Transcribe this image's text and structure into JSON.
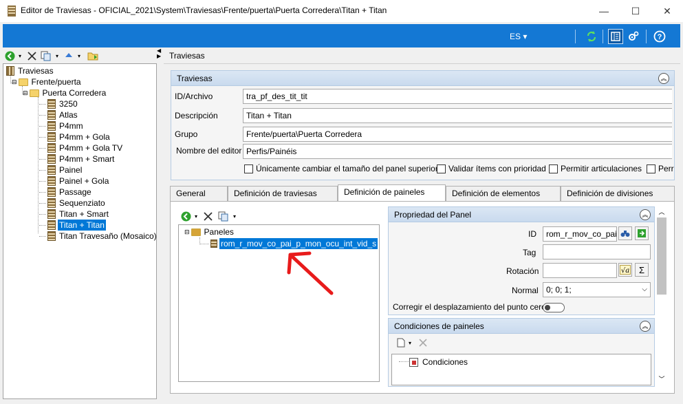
{
  "window": {
    "title": "Editor de Traviesas - OFICIAL_2021\\System\\Traviesas\\Frente/puerta\\Puerta Corredera\\Titan + Titan",
    "minimize_glyph": "—",
    "maximize_glyph": "☐",
    "close_glyph": "✕"
  },
  "ribbon": {
    "language": "ES ▾",
    "accent": "#1478d4",
    "icons": [
      "refresh-icon",
      "panel-view-icon",
      "settings-icon",
      "help-icon"
    ]
  },
  "left_toolbar": {
    "icons": [
      "back-icon",
      "chevron-down-icon",
      "delete-icon",
      "copy-icon",
      "chevron-down-icon",
      "move-up-icon",
      "chevron-down-icon",
      "open-folder-icon"
    ]
  },
  "tree": {
    "root": "Traviesas",
    "folder1": "Frente/puerta",
    "folder2": "Puerta Corredera",
    "items": [
      "3250",
      "Atlas",
      "P4mm",
      "P4mm + Gola",
      "P4mm + Gola TV",
      "P4mm + Smart",
      "Painel",
      "Painel + Gola",
      "Passage",
      "Sequenziato",
      "Titan + Smart",
      "Titan + Titan",
      "Titan Travesaño (Mosaico)"
    ],
    "selected": "Titan + Titan"
  },
  "breadcrumb": "Traviesas",
  "traviesas_group": {
    "header": "Traviesas",
    "fields": {
      "id_label": "ID/Archivo",
      "id_value": "tra_pf_des_tit_tit",
      "desc_label": "Descripción",
      "desc_value": "Titan + Titan",
      "group_label": "Grupo",
      "group_value": "Frente/puerta\\Puerta Corredera",
      "editor_label": "Nombre del editor",
      "editor_value": "Perfis/Painéis"
    },
    "checkboxes": [
      "Únicamente cambiar el tamaño del panel superior",
      "Validar ítems con prioridad",
      "Permitir articulaciones",
      "Perr"
    ]
  },
  "tabs": [
    "General",
    "Definición de traviesas",
    "Definición de paineles",
    "Definición de elementos",
    "Definición de divisiones"
  ],
  "active_tab": "Definición de paineles",
  "panel_tree": {
    "root": "Paneles",
    "item": "rom_r_mov_co_pai_p_mon_ocu_int_vid_s"
  },
  "panel_props": {
    "header": "Propriedad del Panel",
    "id_label": "ID",
    "id_value": "rom_r_mov_co_pai",
    "tag_label": "Tag",
    "tag_value": "",
    "rot_label": "Rotación",
    "rot_value": "",
    "normal_label": "Normal",
    "normal_value": "0; 0; 1;",
    "zero_label": "Corregir el desplazamiento del punto cero",
    "sigma": "Σ"
  },
  "conditions": {
    "header": "Condiciones de paineles",
    "item": "Condiciones"
  }
}
